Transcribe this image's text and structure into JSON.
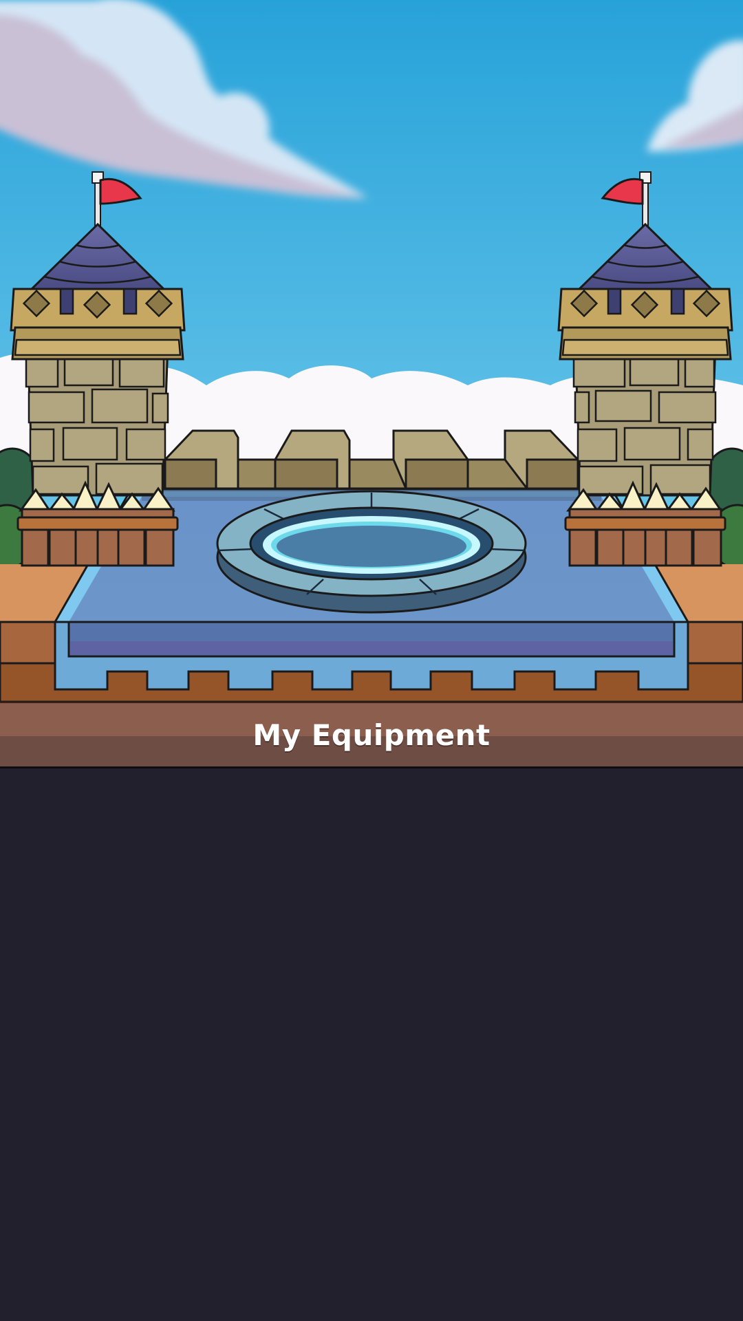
{
  "screen": {
    "title": "My Equipment"
  },
  "colors": {
    "sky_top": "#27a2d9",
    "sky_bottom": "#6ac6ea",
    "page_background": "#22202d",
    "banner_top": "#8b5e4e",
    "banner_bottom": "#6e4e44",
    "platform_blue": "#6a93c9",
    "portal_glow": "#b7f4ff",
    "flag_red": "#e8374a",
    "tower_roof": "#5a5c97",
    "tower_crown": "#c6a862",
    "stone": "#a89d78",
    "fence_wood": "#a26a4a"
  },
  "icons": {
    "left_tower": "castle-tower",
    "right_tower": "castle-tower",
    "portal": "summoning-circle",
    "flags": "pennant-flag"
  }
}
